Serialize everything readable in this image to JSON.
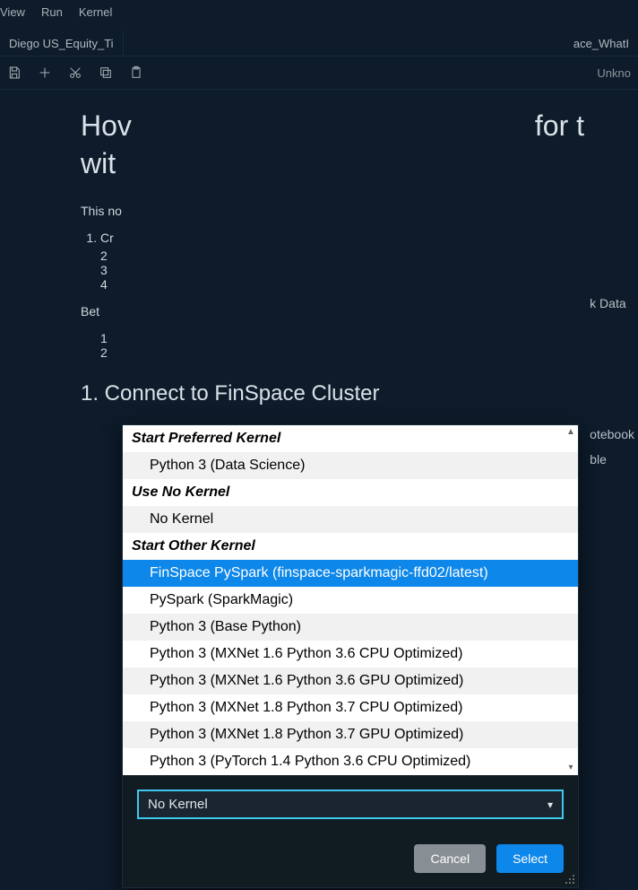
{
  "menubar": {
    "view": "View",
    "run": "Run",
    "kernel": "Kernel"
  },
  "tabs": {
    "left": "Diego US_Equity_Ti",
    "right": "ace_WhatI"
  },
  "toolbar": {
    "kernel_name": "Unkno"
  },
  "doc": {
    "heading_line1": "Hov",
    "heading_line2": "wit",
    "heading_right": "for t",
    "intro": "This no",
    "step1": "Cr",
    "step2": "2",
    "step3": "3",
    "step4": "4",
    "between": "Bet",
    "b1": "1",
    "b2": "2",
    "h2": "1. Connect to FinSpace Cluster"
  },
  "right_extra": {
    "line1": "k Data",
    "line2": "otebook",
    "line3": "ble"
  },
  "dialog": {
    "sections": {
      "preferred_header": "Start Preferred Kernel",
      "preferred_items": [
        "Python 3 (Data Science)"
      ],
      "no_kernel_header": "Use No Kernel",
      "no_kernel_items": [
        "No Kernel"
      ],
      "other_header": "Start Other Kernel",
      "other_items": [
        "FinSpace PySpark (finspace-sparkmagic-ffd02/latest)",
        "PySpark (SparkMagic)",
        "Python 3 (Base Python)",
        "Python 3 (MXNet 1.6 Python 3.6 CPU Optimized)",
        "Python 3 (MXNet 1.6 Python 3.6 GPU Optimized)",
        "Python 3 (MXNet 1.8 Python 3.7 CPU Optimized)",
        "Python 3 (MXNet 1.8 Python 3.7 GPU Optimized)",
        "Python 3 (PyTorch 1.4 Python 3.6 CPU Optimized)"
      ]
    },
    "current_selection": "No Kernel",
    "buttons": {
      "cancel": "Cancel",
      "select": "Select"
    }
  }
}
